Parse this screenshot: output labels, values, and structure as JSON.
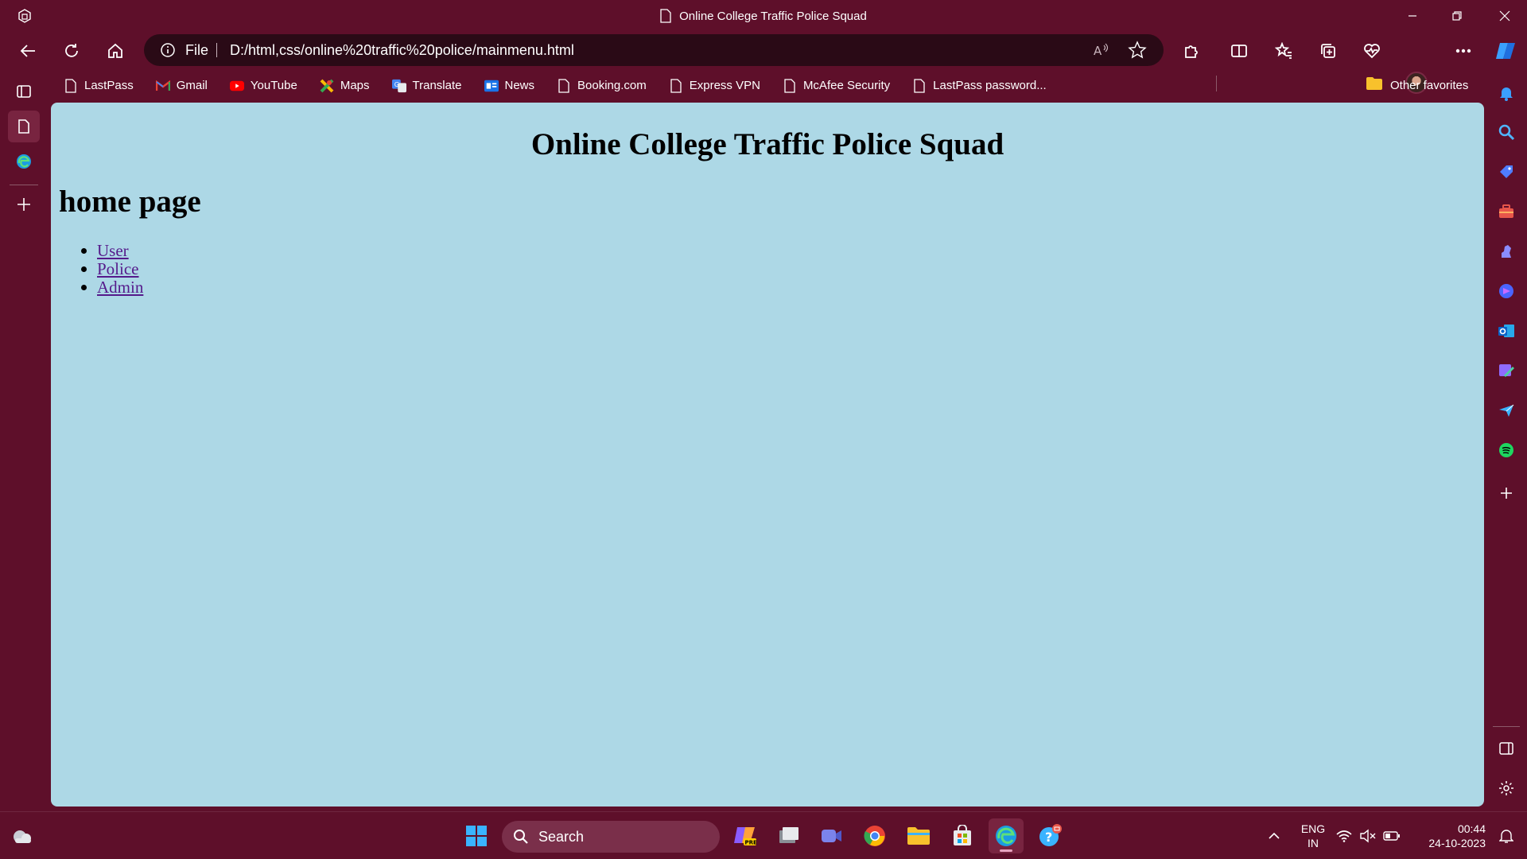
{
  "window": {
    "title": "Online College Traffic Police Squad"
  },
  "addressbar": {
    "scheme": "File",
    "url": "D:/html,css/online%20traffic%20police/mainmenu.html"
  },
  "favorites": {
    "items": [
      {
        "label": "LastPass",
        "icon": "page-icon"
      },
      {
        "label": "Gmail",
        "icon": "gmail-icon"
      },
      {
        "label": "YouTube",
        "icon": "youtube-icon"
      },
      {
        "label": "Maps",
        "icon": "maps-icon"
      },
      {
        "label": "Translate",
        "icon": "translate-icon"
      },
      {
        "label": "News",
        "icon": "news-icon"
      },
      {
        "label": "Booking.com",
        "icon": "page-icon"
      },
      {
        "label": "Express VPN",
        "icon": "page-icon"
      },
      {
        "label": "McAfee Security",
        "icon": "page-icon"
      },
      {
        "label": "LastPass password...",
        "icon": "page-icon"
      }
    ],
    "other": "Other favorites"
  },
  "page": {
    "heading": "Online College Traffic Police Squad",
    "subheading": "home page",
    "links": [
      "User",
      "Police",
      "Admin"
    ],
    "background_color": "#add8e6",
    "link_color": "#551a8b"
  },
  "taskbar": {
    "search_placeholder": "Search",
    "language": "ENG",
    "region": "IN",
    "time": "00:44",
    "date": "24-10-2023"
  },
  "theme": {
    "frame_color": "#5e0f2a",
    "accent": "#782440"
  }
}
